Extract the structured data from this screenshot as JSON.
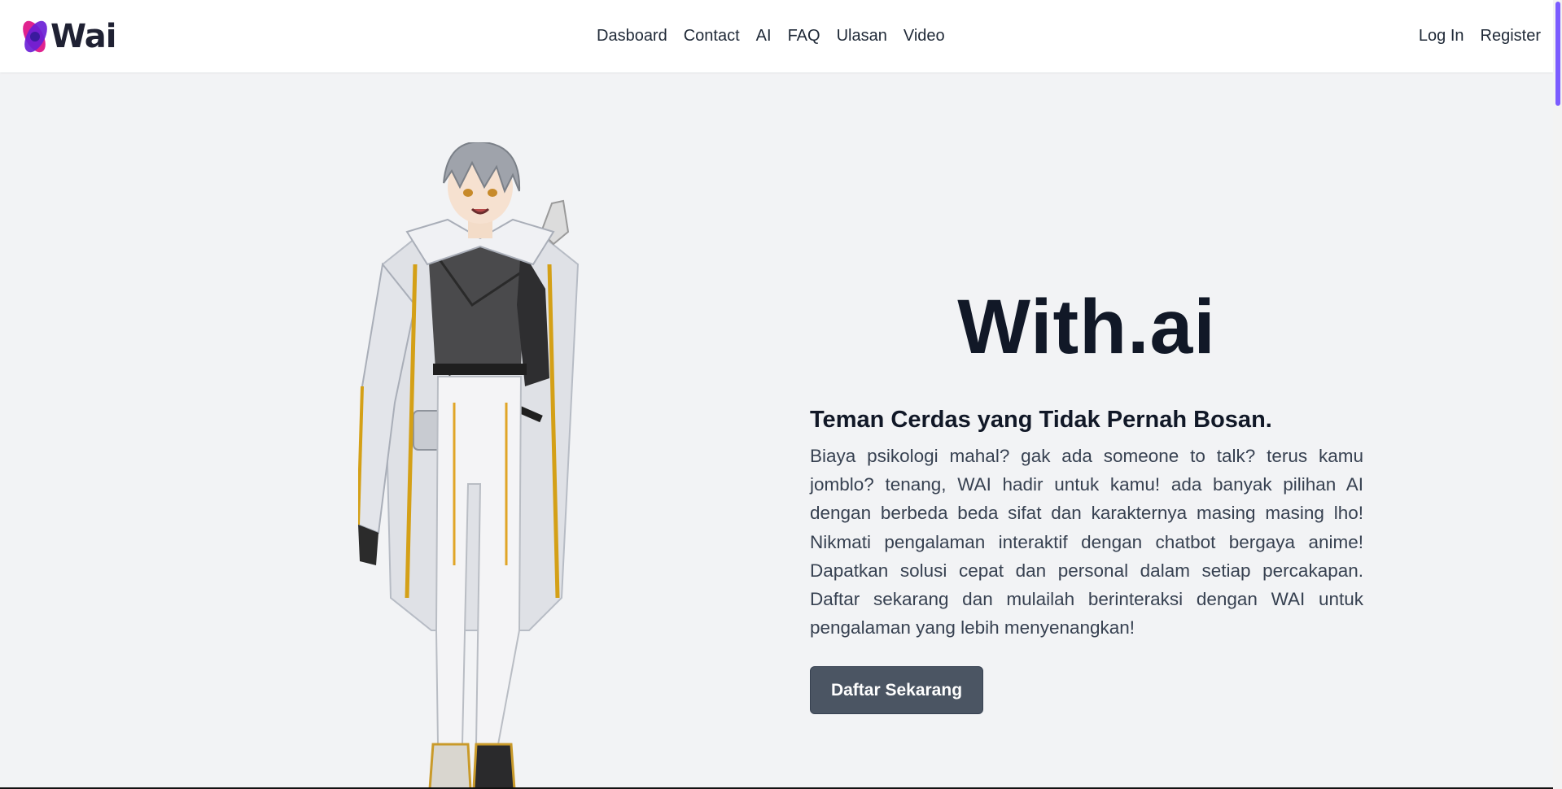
{
  "brand": {
    "name": "Wai"
  },
  "nav": {
    "items": [
      {
        "label": "Dasboard"
      },
      {
        "label": "Contact"
      },
      {
        "label": "AI"
      },
      {
        "label": "FAQ"
      },
      {
        "label": "Ulasan"
      },
      {
        "label": "Video"
      }
    ],
    "login_label": "Log In",
    "register_label": "Register"
  },
  "hero": {
    "title": "With.ai",
    "subtitle": "Teman Cerdas yang Tidak Pernah Bosan.",
    "body": "Biaya psikologi mahal? gak ada someone to talk? terus kamu jomblo? tenang, WAI hadir untuk kamu! ada banyak pilihan AI dengan berbeda beda sifat dan karakternya masing masing lho! Nikmati pengalaman interaktif dengan chatbot bergaya anime! Dapatkan solusi cepat dan personal dalam setiap percakapan. Daftar sekarang dan mulailah berinteraksi dengan WAI untuk pengalaman yang lebih menyenangkan!",
    "cta_label": "Daftar Sekarang"
  },
  "colors": {
    "accent_logo_pink": "#e0238f",
    "accent_logo_purple": "#6a1fd6",
    "background": "#f2f3f5",
    "cta_bg": "#4b5563",
    "scroll_thumb": "#7b5cff"
  },
  "icons": {
    "logo": "wai-logo-icon",
    "character": "anime-character-illustration"
  }
}
